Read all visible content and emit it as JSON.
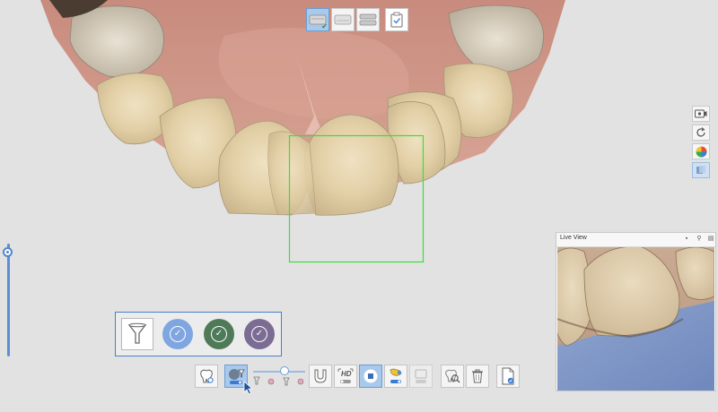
{
  "jaw_selector": {
    "buttons": [
      {
        "name": "upper-jaw",
        "active": true
      },
      {
        "name": "lower-jaw",
        "active": false
      },
      {
        "name": "both-jaws",
        "active": false
      }
    ],
    "clipboard_icon": "clipboard-check-icon"
  },
  "side_toolbar": {
    "icons": [
      "record-icon",
      "rotate-icon",
      "color-wheel-icon",
      "view-mode-icon"
    ]
  },
  "filter_panel": {
    "icon": "funnel-icon",
    "circles": [
      {
        "name": "filter-option-blue",
        "color": "#7fa6e0"
      },
      {
        "name": "filter-option-green",
        "color": "#4e7a58"
      },
      {
        "name": "filter-option-purple",
        "color": "#7b6c93"
      }
    ]
  },
  "bottom_toolbar": {
    "hd_label": "HD",
    "detail_level": 0.6,
    "icons": [
      "tooth-scan-icon",
      "scan-filter-icon",
      "detail-slider",
      "tray-icon",
      "hd-toggle-icon",
      "stop-icon",
      "ai-toggle-icon",
      "disabled-icon",
      "tooth-search-icon",
      "trash-icon",
      "document-icon"
    ]
  },
  "live_view": {
    "title": "Live View"
  },
  "colors": {
    "accent": "#4a7fc9",
    "selection_box": "#3ddc3d",
    "active_button": "#a8c8ec"
  }
}
